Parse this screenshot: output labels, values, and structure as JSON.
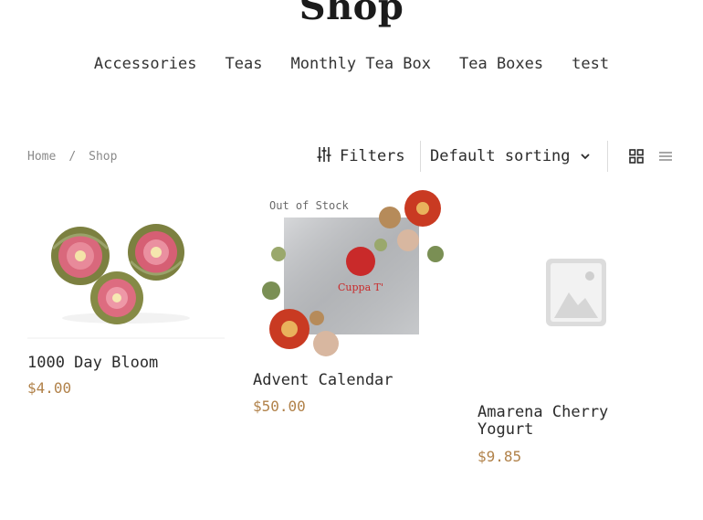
{
  "page": {
    "title": "Shop"
  },
  "nav": {
    "items": [
      "Accessories",
      "Teas",
      "Monthly Tea Box",
      "Tea Boxes",
      "test"
    ]
  },
  "breadcrumb": {
    "home": "Home",
    "separator": "/",
    "current": "Shop"
  },
  "toolbar": {
    "filters_label": "Filters",
    "sorting_value": "Default sorting",
    "grid_view_icon": "grid-icon",
    "list_view_icon": "list-icon"
  },
  "products": [
    {
      "name": "1000 Day Bloom",
      "price": "$4.00",
      "badge": ""
    },
    {
      "name": "Advent Calendar",
      "price": "$50.00",
      "badge": "Out of Stock",
      "image_text": "Cuppa T'"
    },
    {
      "name": "Amarena Cherry Yogurt",
      "price": "$9.85",
      "badge": ""
    }
  ],
  "colors": {
    "price": "#b1824a",
    "text": "#2b2b2b",
    "muted": "#8a8a8a"
  }
}
